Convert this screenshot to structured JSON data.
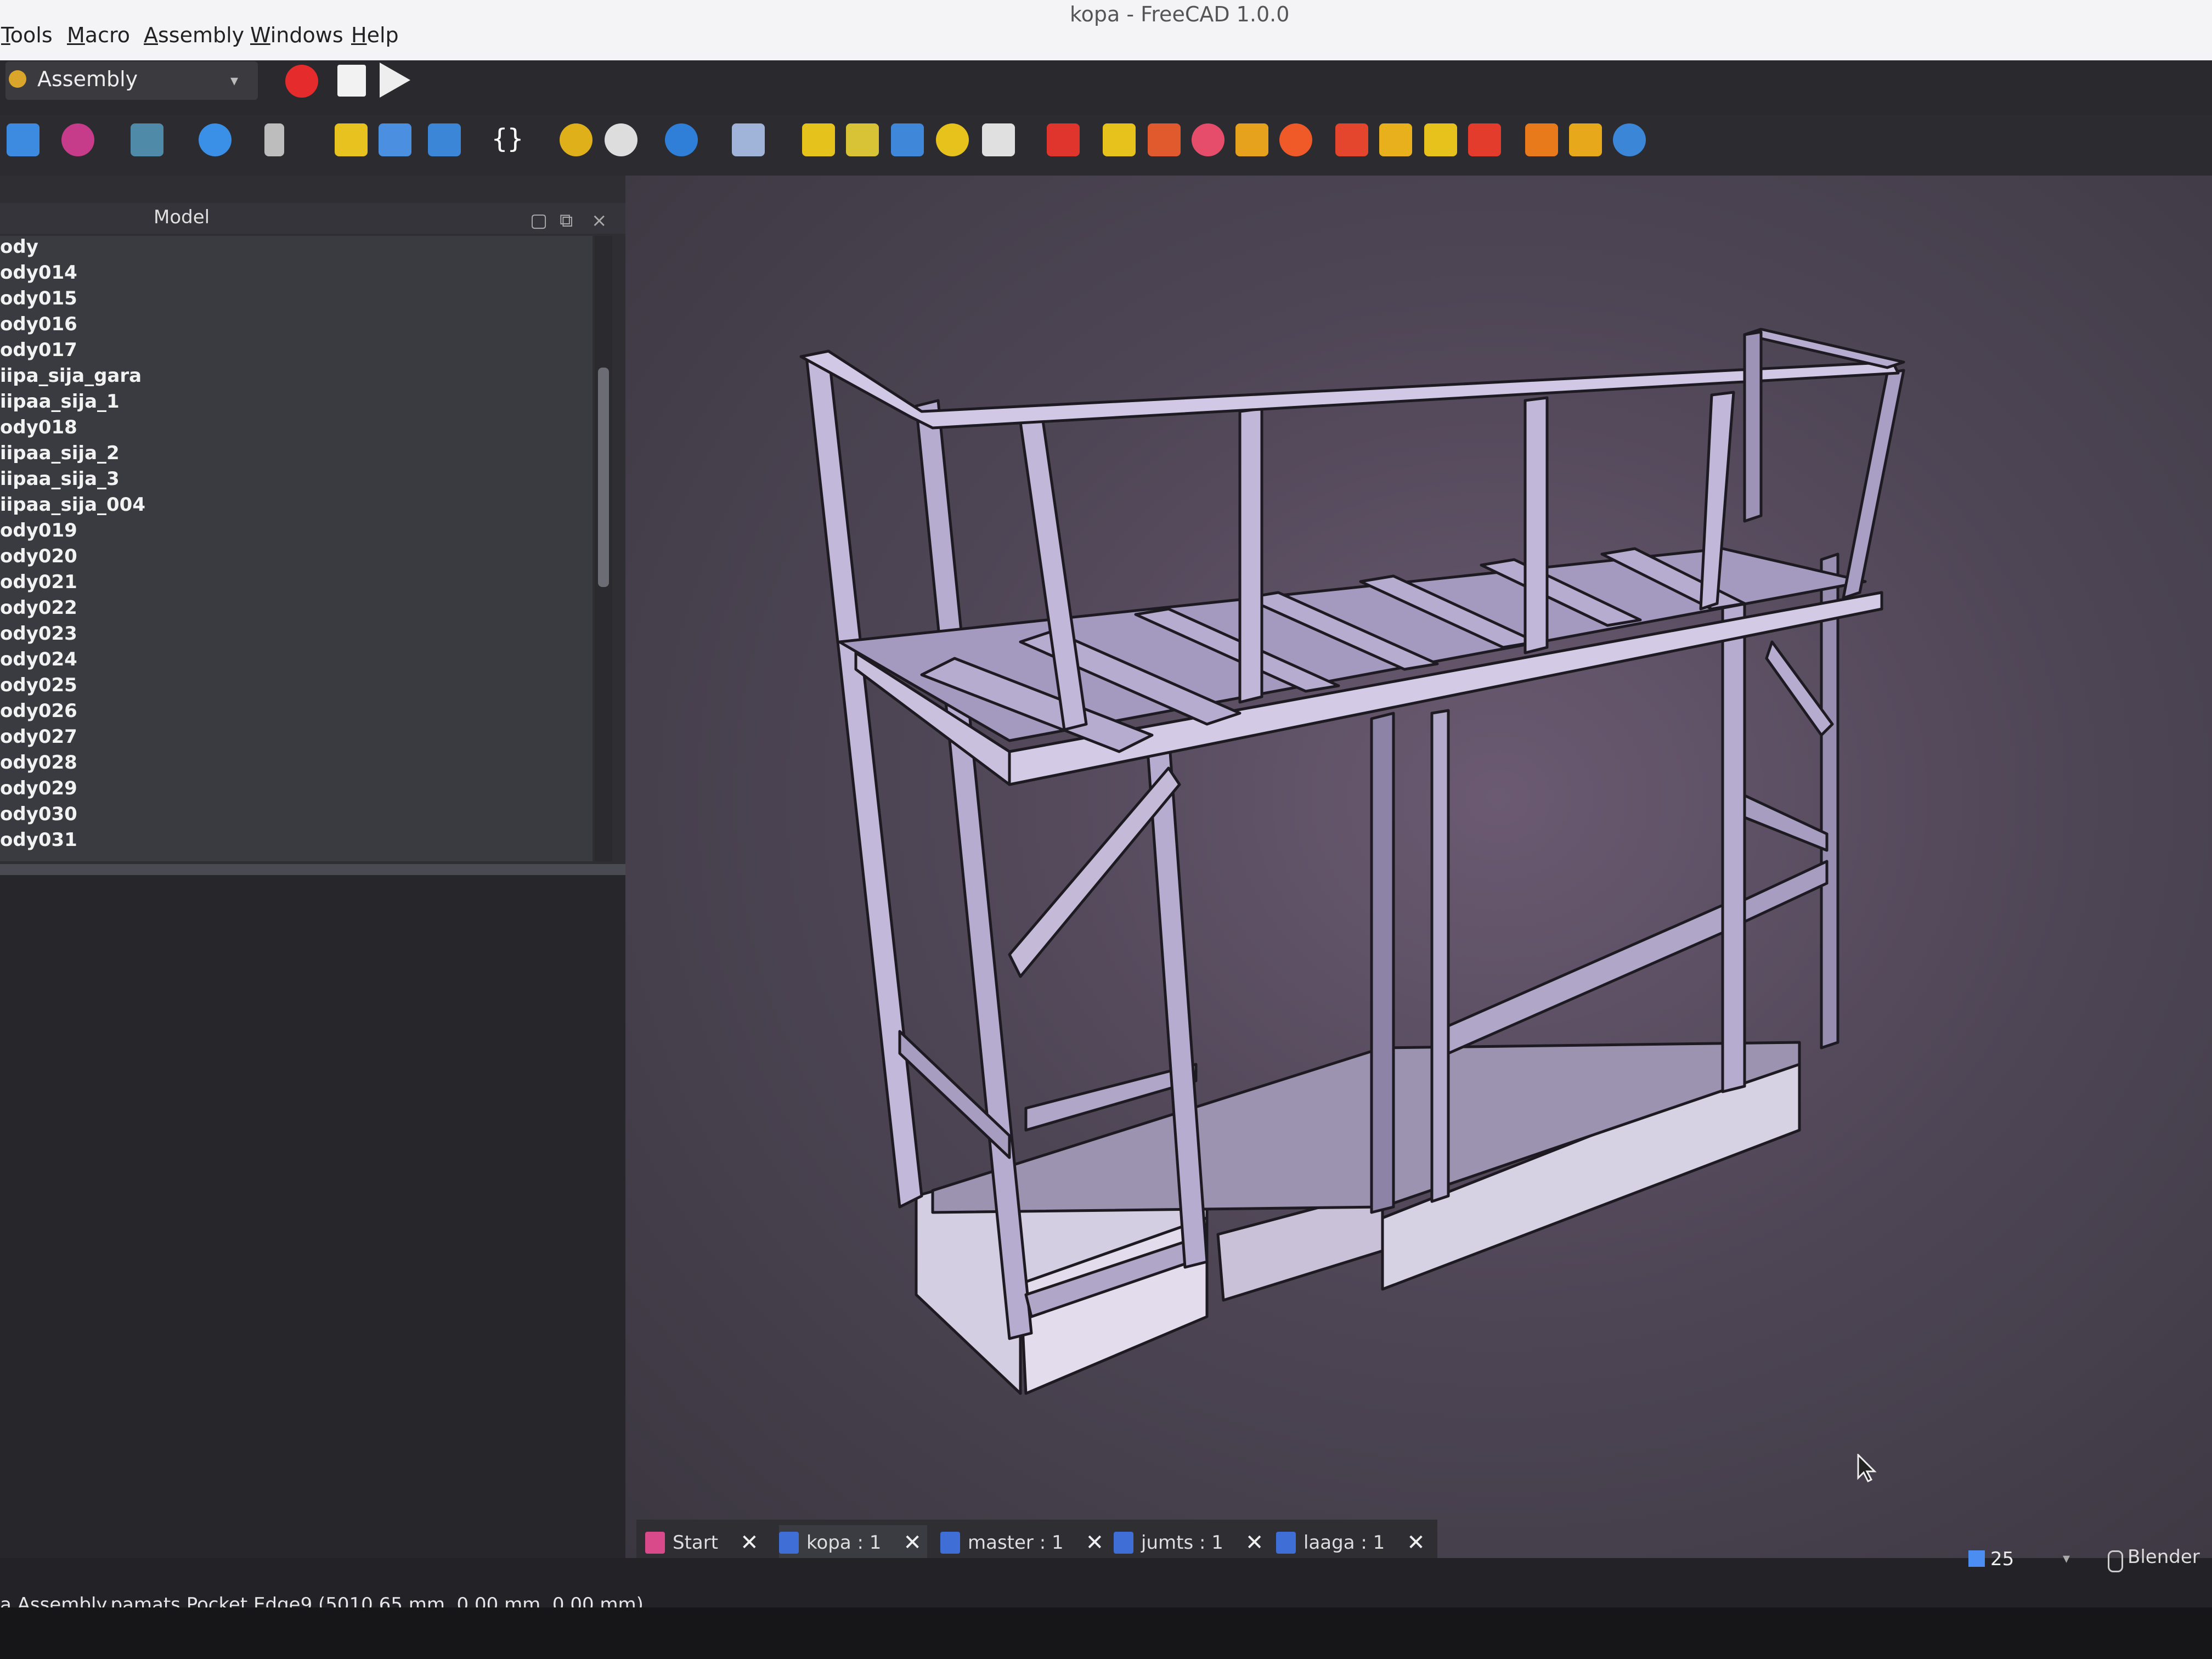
{
  "window": {
    "title": "kopa - FreeCAD 1.0.0"
  },
  "menu": [
    "Tools",
    "Macro",
    "Assembly",
    "Windows",
    "Help"
  ],
  "workbench": {
    "label": "Assembly"
  },
  "model_panel": {
    "title": "Model",
    "tree_items": [
      "ody",
      "ody014",
      "ody015",
      "ody016",
      "ody017",
      "iipa_sija_gara",
      "iipaa_sija_1",
      "ody018",
      "iipaa_sija_2",
      "iipaa_sija_3",
      "iipaa_sija_004",
      "ody019",
      "ody020",
      "ody021",
      "ody022",
      "ody023",
      "ody024",
      "ody025",
      "ody026",
      "ody027",
      "ody028",
      "ody029",
      "ody030",
      "ody031"
    ]
  },
  "tabs": [
    {
      "label": "Start"
    },
    {
      "label": "kopa : 1"
    },
    {
      "label": "master : 1"
    },
    {
      "label": "jumts : 1"
    },
    {
      "label": "laaga : 1"
    }
  ],
  "status": {
    "text": "a.Assembly.pamats.Pocket.Edge9 (5010.65 mm, 0.00 mm, 0.00 mm)",
    "zoom": "25",
    "nav_style": "Blender"
  },
  "colors": {
    "frame_stroke": "#1d1a22",
    "frame_face": "#b6acd0",
    "frame_side": "#8d83a6",
    "base_face": "#cfc9dd"
  }
}
